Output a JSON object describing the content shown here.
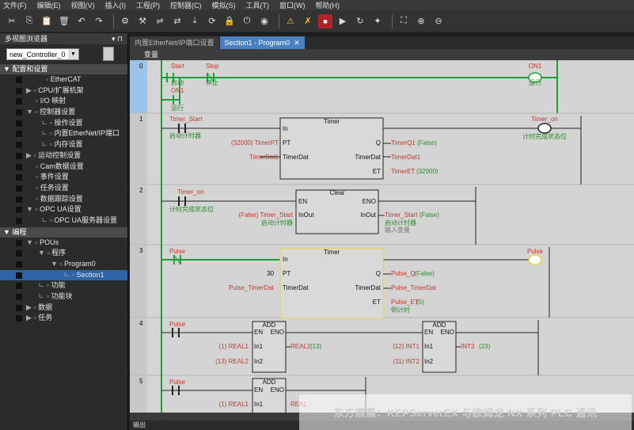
{
  "menu": [
    "文件(F)",
    "编辑(E)",
    "视图(V)",
    "插入(I)",
    "工程(P)",
    "控制器(C)",
    "模拟(S)",
    "工具(T)",
    "窗口(W)",
    "帮助(H)"
  ],
  "toolbar": {
    "icons": [
      "cut-icon",
      "copy-icon",
      "paste-icon",
      "delete-icon",
      "undo-icon",
      "redo-icon",
      "build-icon",
      "tools-icon",
      "network-icon",
      "compare-icon",
      "transfer-icon",
      "sync-icon",
      "lock-icon",
      "online-icon",
      "monitor-icon",
      "warning-icon",
      "forced-icon",
      "stop-icon",
      "run-icon",
      "refresh-icon",
      "settings-icon",
      "fit-icon",
      "zoom-in-icon",
      "zoom-out-icon"
    ]
  },
  "left_panel": {
    "title": "多视图浏览器",
    "pin": "▾ ⊓",
    "controller": "new_Controller_0",
    "config_section": "配置和设置",
    "config_items": [
      {
        "label": "EtherCAT",
        "indent": 58,
        "prefix": ""
      },
      {
        "label": "CPU/扩展机架",
        "indent": 33,
        "prefix": "▶"
      },
      {
        "label": "I/O 映射",
        "indent": 45,
        "prefix": ""
      },
      {
        "label": "控制器设置",
        "indent": 33,
        "prefix": "▼"
      },
      {
        "label": "操作设置",
        "indent": 52,
        "prefix": "ㄴ"
      },
      {
        "label": "内置EtherNet/IP端口",
        "indent": 52,
        "prefix": "ㄴ"
      },
      {
        "label": "内存设置",
        "indent": 52,
        "prefix": "ㄴ"
      },
      {
        "label": "运动控制设置",
        "indent": 33,
        "prefix": "▶"
      },
      {
        "label": "Cam数据设置",
        "indent": 45,
        "prefix": ""
      },
      {
        "label": "事件设置",
        "indent": 45,
        "prefix": ""
      },
      {
        "label": "任务设置",
        "indent": 45,
        "prefix": ""
      },
      {
        "label": "数据跟踪设置",
        "indent": 45,
        "prefix": ""
      },
      {
        "label": "OPC UA设置",
        "indent": 33,
        "prefix": "▼"
      },
      {
        "label": "OPC UA服务器设置",
        "indent": 52,
        "prefix": "ㄴ"
      }
    ],
    "program_section": "编程",
    "program_items": [
      {
        "label": "POUs",
        "indent": 33,
        "prefix": "▼",
        "selected": false
      },
      {
        "label": "程序",
        "indent": 48,
        "prefix": "▼",
        "selected": false
      },
      {
        "label": "Program0",
        "indent": 64,
        "prefix": "▼",
        "selected": false
      },
      {
        "label": "Section1",
        "indent": 80,
        "prefix": "ㄴ",
        "selected": true
      },
      {
        "label": "功能",
        "indent": 48,
        "prefix": "ㄴ",
        "selected": false
      },
      {
        "label": "功能块",
        "indent": 48,
        "prefix": "ㄴ",
        "selected": false
      },
      {
        "label": "数据",
        "indent": 33,
        "prefix": "▶",
        "selected": false
      },
      {
        "label": "任务",
        "indent": 33,
        "prefix": "▶",
        "selected": false
      }
    ]
  },
  "tabs": [
    {
      "label": "内置EtherNet/IP端口设置",
      "active": false
    },
    {
      "label": "Section1 - Program0",
      "active": true,
      "close": "✕"
    }
  ],
  "variables_label": "变量",
  "ladder": {
    "rungs": [
      {
        "num": "0"
      },
      {
        "num": "1"
      },
      {
        "num": "2"
      },
      {
        "num": "3"
      },
      {
        "num": "4"
      },
      {
        "num": "5"
      }
    ],
    "r0": {
      "c1": "Start",
      "c1c": "启动",
      "c2": "Stop",
      "c2c": "停止",
      "c3": "ON1",
      "c3c": "运行",
      "coil": "ON1",
      "coilc": "运行"
    },
    "r1": {
      "contact": "Timer_Start",
      "contactc": "启动计时器",
      "fb": "Timer",
      "in": "In",
      "pt": "PT",
      "q": "Q",
      "td": "TimerDat",
      "et": "ET",
      "pt_in": "(32000) TimerPT",
      "td_in": "TimerDat1",
      "q_out": "TimerQ1",
      "q_val": "(False)",
      "td_out": "TimerDat1",
      "et_out": "TimerET",
      "et_val": "(32000)",
      "coil": "Timer_on",
      "coilc": "计时完成状态位"
    },
    "r2": {
      "contact": "Timer_on",
      "contactc": "计时完成状态位",
      "fb": "Clear",
      "en": "EN",
      "eno": "ENO",
      "inout": "InOut",
      "in_var": "(False) Timer_Start",
      "in_varc": "启动计时器",
      "out_var": "Timer_Start",
      "out_val": "(False)",
      "out_c1": "启动计时器",
      "out_c2": "输入变量"
    },
    "r3": {
      "contact": "Pulse",
      "fb": "Timer",
      "in": "In",
      "pt": "PT",
      "q": "Q",
      "td": "TimerDat",
      "et": "ET",
      "pt_in": "30",
      "td_in": "Pulse_TimerDat",
      "q_out": "Pulse_Q",
      "q_val": "(False)",
      "td_out": "Pulse_TimerDat",
      "et_out": "Pulse_ET",
      "et_val": "(5)",
      "et_c": "倒计时",
      "coil": "Pulse"
    },
    "r4": {
      "contact": "Pulse",
      "fb1": "ADD",
      "fb2": "ADD",
      "en": "EN",
      "eno": "ENO",
      "in1": "In1",
      "in2": "In2",
      "a_in1": "(1) REAL1",
      "a_in2": "(13) REAL2",
      "a_out": "REAL2",
      "a_outv": "(13)",
      "b_in1": "(12)  INT1",
      "b_in2": "(11)  INT2",
      "b_out": "INT3",
      "b_outv": "(23)"
    },
    "r5": {
      "contact": "Pulse",
      "fb": "ADD",
      "en": "EN",
      "eno": "ENO",
      "in1": "In1",
      "in2": "In2",
      "a_in1": "(1) REAL1",
      "a_out": "REAL"
    }
  },
  "bottom_label": "输出",
  "watermark": "东方鼎晨：KEPServerEX 与欧姆龙 NX 系列 PLC 通讯",
  "colors": {
    "power": "#1f9e3a",
    "selected": "#2f63a8",
    "tab_active": "#4b7fc4",
    "highlight": "#e8d24a"
  }
}
